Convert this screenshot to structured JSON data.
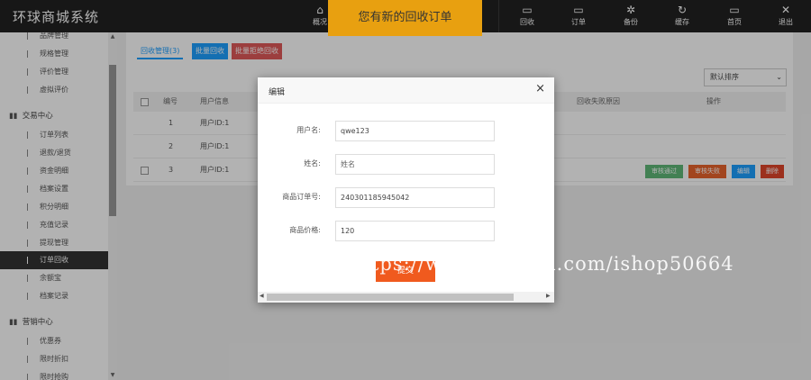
{
  "app": {
    "title": "环球商城系统"
  },
  "topnav": [
    {
      "label": "概况",
      "icon": "home-icon",
      "glyph": "⌂"
    },
    {
      "label": "回收",
      "icon": "monitor-icon",
      "glyph": "▭"
    },
    {
      "label": "订单",
      "icon": "monitor-icon",
      "glyph": "▭"
    },
    {
      "label": "备份",
      "icon": "gear-icon",
      "glyph": "✲"
    },
    {
      "label": "缓存",
      "icon": "refresh-icon",
      "glyph": "↻"
    },
    {
      "label": "首页",
      "icon": "monitor-icon",
      "glyph": "▭"
    },
    {
      "label": "退出",
      "icon": "close-icon",
      "glyph": "✕"
    }
  ],
  "notice": "您有新的回收订单",
  "sidebar": {
    "items_top": [
      "品牌管理",
      "规格管理",
      "评价管理",
      "虚拟评价"
    ],
    "group_trade": "交易中心",
    "items_trade": [
      "订单列表",
      "退款/退货",
      "资金明细",
      "档案设置",
      "积分明细",
      "充值记录",
      "提现管理",
      "订单回收",
      "余额宝",
      "档案记录"
    ],
    "active": "订单回收",
    "group_marketing": "营销中心",
    "items_marketing": [
      "优惠券",
      "限时折扣",
      "限时抢购"
    ]
  },
  "tabs": {
    "current": "回收管理(3)",
    "batch_recycle": "批量回收",
    "batch_reject": "批量拒绝回收"
  },
  "sort": {
    "selected": "默认排序",
    "caret": "⌄"
  },
  "table": {
    "headers": {
      "id": "编号",
      "user": "用户信息",
      "reason": "回收失败原因",
      "action": "操作"
    },
    "rows": [
      {
        "id": "1",
        "user": "用户ID:1"
      },
      {
        "id": "2",
        "user": "用户ID:1"
      },
      {
        "id": "3",
        "user": "用户ID:1"
      }
    ],
    "actions": {
      "approve": "审核通过",
      "reject": "审核失败",
      "edit": "编辑",
      "delete": "删除"
    }
  },
  "modal": {
    "title": "编辑",
    "close": "×",
    "fields": {
      "username": {
        "label": "用户名:",
        "value": "qwe123"
      },
      "realname": {
        "label": "姓名:",
        "placeholder": "姓名"
      },
      "order_no": {
        "label": "商品订单号:",
        "value": "240301185945042"
      },
      "price": {
        "label": "商品价格:",
        "value": "120"
      }
    },
    "submit": "提交"
  },
  "watermark": "https://www.huzhan.com/ishop50664",
  "colors": {
    "topbar": "#222222",
    "notice": "#e8a010",
    "submit": "#f05a1e",
    "approve": "#5fb878",
    "reject": "#e8632b",
    "edit": "#1e9fff",
    "delete": "#e0462a"
  }
}
